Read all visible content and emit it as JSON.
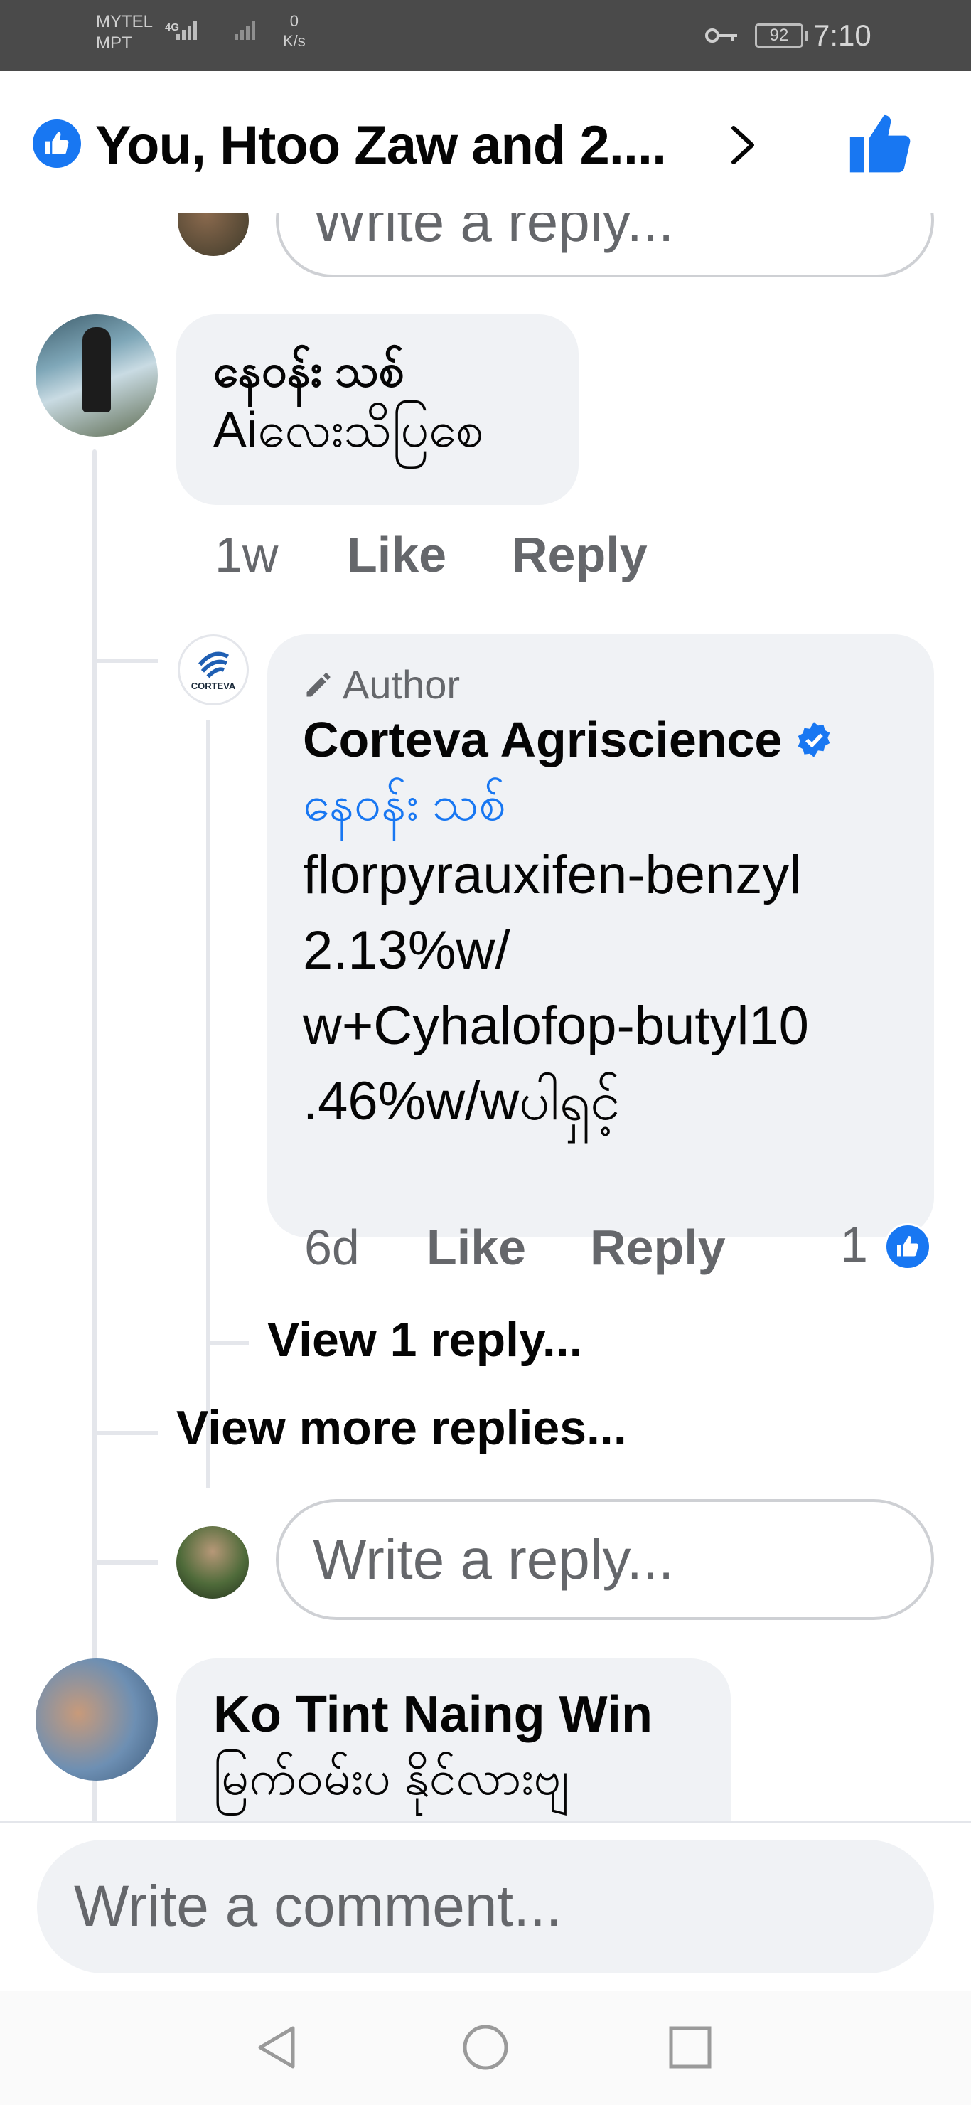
{
  "status_bar": {
    "carrier1": "MYTEL",
    "carrier2": "MPT",
    "network": "4G",
    "speed_value": "0",
    "speed_unit": "K/s",
    "battery": "92",
    "time": "7:10"
  },
  "header": {
    "reactions_text": "You, Htoo Zaw and 2....",
    "accent": "#1877f2"
  },
  "thread": {
    "prev_reply_placeholder": "Write a reply...",
    "comment1": {
      "author": "နေဝန်း သစ်",
      "text": "Aiလေးသိပြစေ",
      "time": "1w",
      "like_label": "Like",
      "reply_label": "Reply"
    },
    "reply1": {
      "badge": "Author",
      "author": "Corteva Agriscience",
      "logo_text": "CORTEVA",
      "mention": "နေဝန်း သစ်",
      "lines": [
        "florpyrauxifen-benzyl",
        "2.13%w/",
        "w+Cyhalofop-butyl10",
        ".46%w/wပါရှင့်"
      ],
      "time": "6d",
      "like_label": "Like",
      "reply_label": "Reply",
      "like_count": "1"
    },
    "view_reply": "View 1 reply...",
    "view_more": "View more replies...",
    "reply_placeholder": "Write a reply..."
  },
  "comment2": {
    "author": "Ko Tint Naing Win",
    "text": "မြက်ဝမ်းပ နိုင်လားဗျ"
  },
  "composer": {
    "placeholder": "Write a comment..."
  }
}
